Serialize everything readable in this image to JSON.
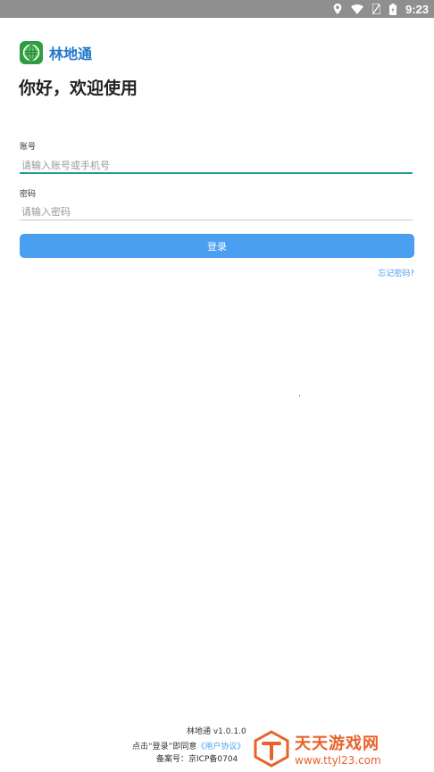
{
  "status_bar": {
    "time": "9:23",
    "icons": [
      "location-icon",
      "wifi-icon",
      "no-sim-icon",
      "battery-icon"
    ]
  },
  "app": {
    "name": "林地通",
    "greeting": "你好，欢迎使用",
    "brand_color": "#2277cc",
    "logo_color": "#2e9d42"
  },
  "form": {
    "account_label": "账号",
    "account_placeholder": "请输入账号或手机号",
    "password_label": "密码",
    "password_placeholder": "请输入密码",
    "login_label": "登录",
    "forgot_label": "忘记密码?",
    "accent_color": "#4a9ff0"
  },
  "footer": {
    "version": "林地通 v1.0.1.0",
    "agreement_prefix": "点击“登录”即同意",
    "agreement_link": "《用户协议》",
    "icp": "备案号：京ICP备0704"
  },
  "watermark": {
    "title": "天天游戏网",
    "url": "www.ttyl23.com"
  }
}
